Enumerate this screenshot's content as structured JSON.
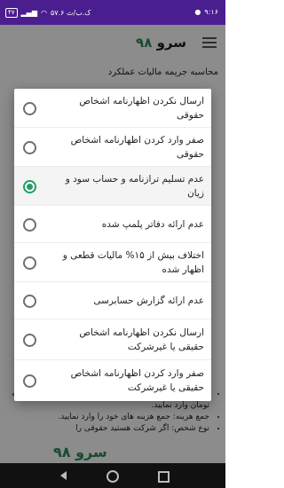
{
  "status_bar": {
    "time": "۹:۱۶",
    "speed": "۵۷.۶ ک.ب/ث",
    "battery": "۴۷",
    "signal_icon": "signal-icon",
    "wifi_icon": "wifi-icon"
  },
  "app_bar": {
    "title": "سرو",
    "title_number": "۹۸",
    "menu_icon": "hamburger-menu-icon"
  },
  "page": {
    "subtitle": "محاسبه جریمه مالیات عملکرد",
    "bullets": [
      "جمع درآمد: جمع فروش خود را چه کالا باشد و چه خدمات به تومان وارد نمایید.",
      "جمع هزینه: جمع هزینه های خود را وارد نمایید.",
      "نوع شخص: اگر شرکت هستید حقوقی را"
    ],
    "footer_brand": "سرو ۹۸"
  },
  "dialog": {
    "selected_index": 2,
    "options": [
      {
        "label": "ارسال نکردن اظهارنامه اشخاص حقوقی"
      },
      {
        "label": "صفر وارد کردن اظهارنامه اشخاص حقوقی"
      },
      {
        "label": "عدم تسلیم ترازنامه و حساب سود و زیان"
      },
      {
        "label": "عدم ارائه دفاتر پلمپ شده"
      },
      {
        "label": "اختلاف بیش از ۱۵% مالیات قطعی و اظهار شده"
      },
      {
        "label": "عدم ارائه گزارش حسابرسی"
      },
      {
        "label": "ارسال نکردن اظهارنامه اشخاص حقیقی یا غیرشرکت"
      },
      {
        "label": "صفر وارد کردن اظهارنامه اشخاص حقیقی یا غیرشرکت"
      }
    ]
  },
  "nav_bar": {
    "back_icon": "back-triangle-icon",
    "home_icon": "home-circle-icon",
    "recents_icon": "recents-square-icon"
  }
}
